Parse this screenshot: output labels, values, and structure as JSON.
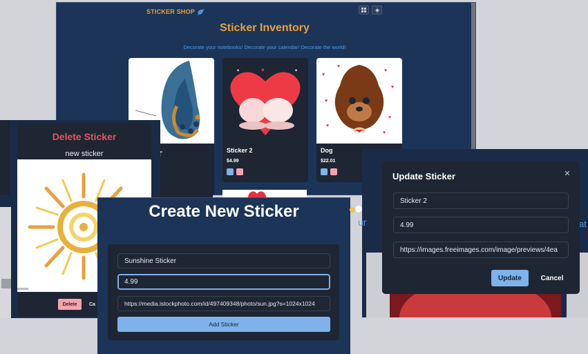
{
  "main_window": {
    "brand": "STICKER SHOP",
    "header_title": "Sticker Inventory",
    "subtitle": "Decorate your notebooks! Decorate your calendar! Decorate the world!",
    "cards": [
      {
        "name": "T",
        "price": "$"
      },
      {
        "name": "Sticker 2",
        "price": "$4.99"
      },
      {
        "name": "Dog",
        "price": "$22.01"
      }
    ]
  },
  "delete_modal": {
    "title": "Delete Sticker",
    "sticker_name": "new sticker",
    "delete_label": "Delete",
    "cancel_label": "Ca"
  },
  "create_modal": {
    "title": "Create New Sticker",
    "name_value": "Sunshine Sticker",
    "price_value": "4.99",
    "url_value": "https://media.istockphoto.com/id/497409348/photo/sun.jpg?s=1024x1024",
    "add_label": "Add Sticker"
  },
  "update_modal": {
    "title": "Update Sticker",
    "close_glyph": "✕",
    "name_value": "Sticker 2",
    "price_value": "4.99",
    "url_value": "https://images.freeimages.com/image/previews/4ea",
    "update_label": "Update",
    "cancel_label": "Cancel"
  },
  "bg_fragments": {
    "partial_text": "ur",
    "partial_text_right": "at"
  },
  "colors": {
    "navy": "#1b3457",
    "card": "#1e2533",
    "accent_orange": "#e9a03b",
    "accent_blue": "#7fb2ea",
    "delete_red": "#e8545e",
    "delete_pink": "#f4a3ad"
  }
}
